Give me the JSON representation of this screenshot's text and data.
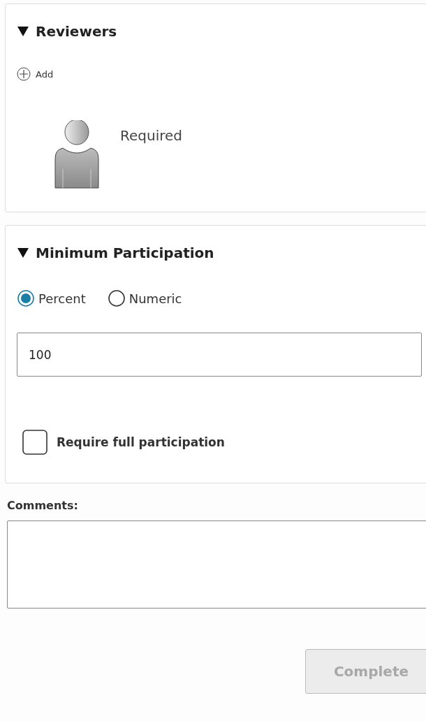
{
  "reviewers": {
    "title": "Reviewers",
    "expanded": true,
    "add_label": "Add",
    "items": [
      {
        "label": "Required"
      }
    ]
  },
  "minimum_participation": {
    "title": "Minimum Participation",
    "expanded": true,
    "options": [
      {
        "label": "Percent",
        "selected": true
      },
      {
        "label": "Numeric",
        "selected": false
      }
    ],
    "value": "100",
    "require_full": {
      "label": "Require full participation",
      "checked": false
    }
  },
  "comments": {
    "label": "Comments:"
  },
  "buttons": [
    {
      "label": "Complete",
      "disabled": true
    }
  ]
}
